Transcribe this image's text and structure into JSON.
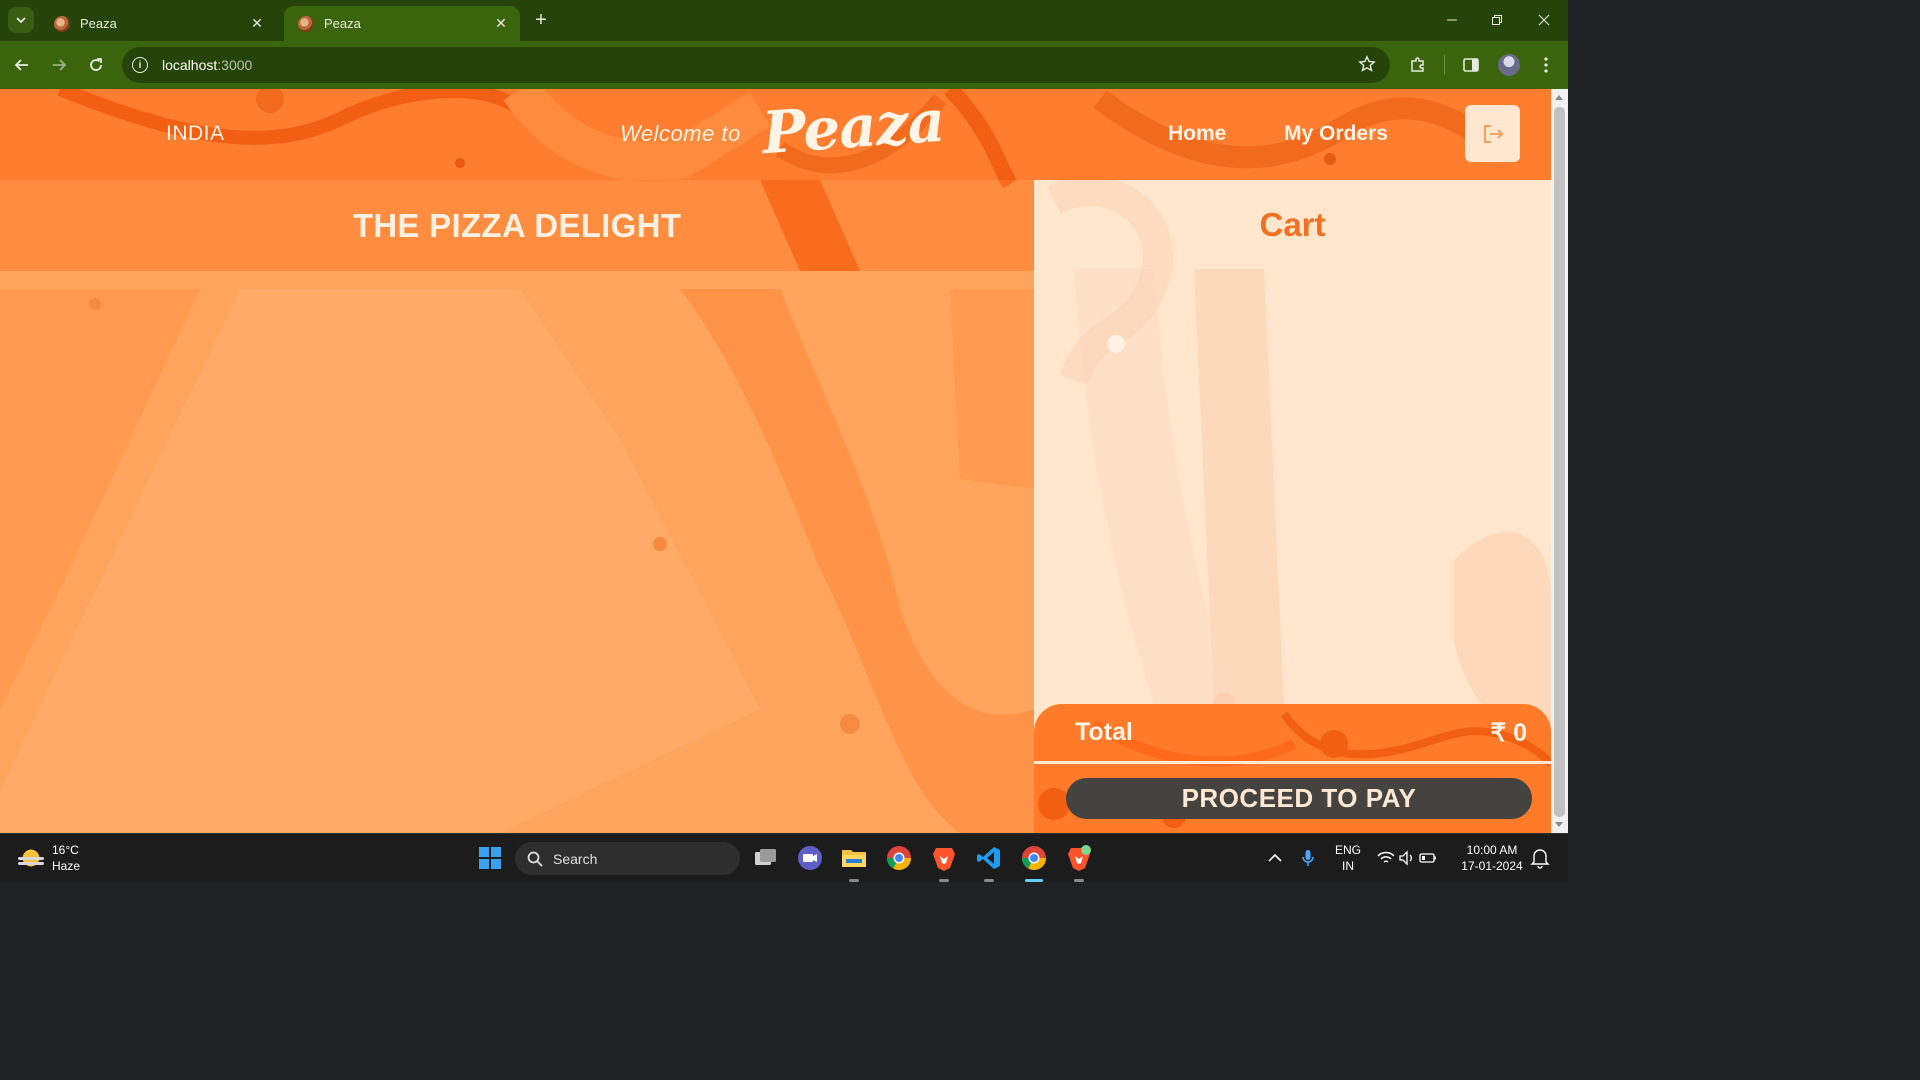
{
  "browser": {
    "tabs": [
      {
        "title": "Peaza",
        "active": false
      },
      {
        "title": "Peaza",
        "active": true
      }
    ],
    "url_host": "localhost",
    "url_port": ":3000"
  },
  "nav": {
    "country": "INDIA",
    "welcome": "Welcome to",
    "brand": "Peaza",
    "exclaim": "!",
    "links": [
      "Home",
      "My Orders"
    ]
  },
  "menu": {
    "title": "THE PIZZA DELIGHT"
  },
  "cart": {
    "title": "Cart",
    "total_label": "Total",
    "total_value": "₹ 0",
    "pay_label": "PROCEED TO PAY"
  },
  "taskbar": {
    "weather_temp": "16°C",
    "weather_desc": "Haze",
    "search_label": "Search",
    "lang_line1": "ENG",
    "lang_line2": "IN",
    "time": "10:00 AM",
    "date": "17-01-2024"
  },
  "colors": {
    "page_orange": "#ffa45c",
    "accent_orange": "#f27022",
    "cart_bg": "#ffecd6",
    "pay_button": "#454340",
    "browser_frame": "#26440a"
  }
}
